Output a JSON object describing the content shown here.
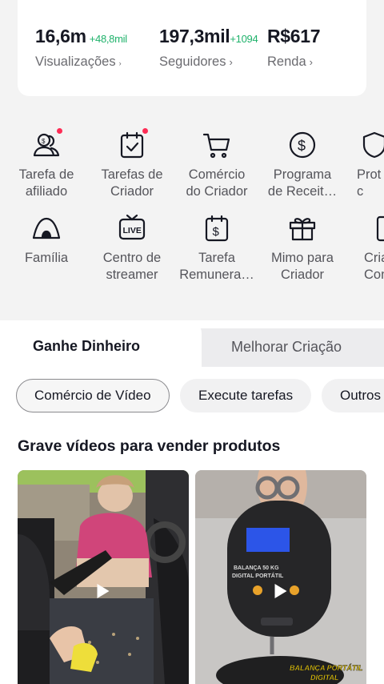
{
  "stats": [
    {
      "value": "16,6m",
      "delta": "+48,8mil",
      "label": "Visualizações",
      "arrow": "›"
    },
    {
      "value": "197,3mil",
      "delta": "+1094",
      "label": "Seguidores",
      "arrow": "›"
    },
    {
      "value": "R$617",
      "delta": "",
      "label": "Renda",
      "arrow": "›"
    }
  ],
  "tools_row1": [
    {
      "label": "Tarefa de\nafiliado",
      "icon": "affiliate-icon",
      "badge": true
    },
    {
      "label": "Tarefas de\nCriador",
      "icon": "task-check-icon",
      "badge": true
    },
    {
      "label": "Comércio\ndo Criador",
      "icon": "cart-icon",
      "badge": false
    },
    {
      "label": "Programa\nde Receit…",
      "icon": "dollar-circle-icon",
      "badge": false
    },
    {
      "label": "Prot\nc",
      "icon": "shield-icon",
      "badge": false
    }
  ],
  "tools_row2": [
    {
      "label": "Família",
      "icon": "tent-icon"
    },
    {
      "label": "Centro de\nstreamer",
      "icon": "live-tv-icon"
    },
    {
      "label": "Tarefa\nRemunera…",
      "icon": "dollar-calendar-icon"
    },
    {
      "label": "Mimo para\nCriador",
      "icon": "gift-icon"
    },
    {
      "label": "Cria\nContr",
      "icon": "document-icon"
    }
  ],
  "tabs": [
    {
      "label": "Ganhe Dinheiro",
      "active": true
    },
    {
      "label": "Melhorar Criação",
      "active": false
    }
  ],
  "pills": [
    {
      "label": "Comércio de Vídeo",
      "selected": true
    },
    {
      "label": "Execute tarefas",
      "selected": false
    },
    {
      "label": "Outros",
      "selected": false
    }
  ],
  "section": {
    "title": "Grave vídeos para vender produtos"
  },
  "videos": [
    {
      "desc": "thumbnail-1"
    },
    {
      "overlay_text": "BALANÇA PORTÁTIL DIGITAL",
      "device_text": "BALANÇA 50 KG DIGITAL PORTÁTIL"
    }
  ],
  "colors": {
    "accent": "#fe2c55",
    "positive": "#1fb26b"
  }
}
